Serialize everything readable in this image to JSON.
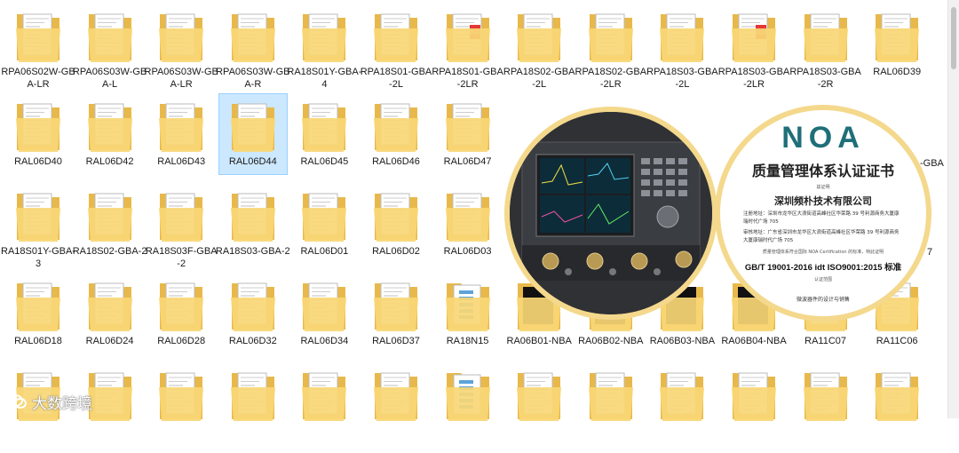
{
  "explorer": {
    "selected_index": 16,
    "items": [
      {
        "name": "RPA06S02W-GBA-LR",
        "variant": "doc"
      },
      {
        "name": "RPA06S03W-GBA-L",
        "variant": "doc"
      },
      {
        "name": "RPA06S03W-GBA-LR",
        "variant": "doc"
      },
      {
        "name": "RPA06S03W-GBA-R",
        "variant": "doc"
      },
      {
        "name": "RA18S01Y-GBA-4",
        "variant": "doc"
      },
      {
        "name": "RPA18S01-GBA-2L",
        "variant": "doc"
      },
      {
        "name": "RPA18S01-GBA-2LR",
        "variant": "pdf"
      },
      {
        "name": "RPA18S02-GBA-2L",
        "variant": "doc"
      },
      {
        "name": "RPA18S02-GBA-2LR",
        "variant": "doc"
      },
      {
        "name": "RPA18S03-GBA-2L",
        "variant": "doc"
      },
      {
        "name": "RPA18S03-GBA-2LR",
        "variant": "pdf"
      },
      {
        "name": "RPA18S03-GBA-2R",
        "variant": "doc"
      },
      {
        "name": "RAL06D39",
        "variant": "doc"
      },
      {
        "name": "RAL06D40",
        "variant": "doc"
      },
      {
        "name": "RAL06D42",
        "variant": "doc"
      },
      {
        "name": "RAL06D43",
        "variant": "doc"
      },
      {
        "name": "RAL06D44",
        "variant": "doc"
      },
      {
        "name": "RAL06D45",
        "variant": "doc"
      },
      {
        "name": "RAL06D46",
        "variant": "doc"
      },
      {
        "name": "RAL06D47",
        "variant": "doc"
      },
      {
        "name": "",
        "variant": "hidden"
      },
      {
        "name": "",
        "variant": "hidden"
      },
      {
        "name": "",
        "variant": "hidden"
      },
      {
        "name": "",
        "variant": "hidden"
      },
      {
        "name": "",
        "variant": "hidden"
      },
      {
        "name": "",
        "variant": "hidden"
      },
      {
        "name": "RA18S01Y-GBA-3",
        "variant": "doc"
      },
      {
        "name": "RA18S02-GBA-2",
        "variant": "doc"
      },
      {
        "name": "RA18S03F-GBA-2",
        "variant": "doc"
      },
      {
        "name": "RA18S03-GBA-2",
        "variant": "doc"
      },
      {
        "name": "RAL06D01",
        "variant": "doc"
      },
      {
        "name": "RAL06D02",
        "variant": "doc"
      },
      {
        "name": "RAL06D03",
        "variant": "doc"
      },
      {
        "name": "",
        "variant": "hidden"
      },
      {
        "name": "",
        "variant": "hidden"
      },
      {
        "name": "",
        "variant": "hidden"
      },
      {
        "name": "",
        "variant": "hidden"
      },
      {
        "name": "",
        "variant": "hidden"
      },
      {
        "name": "",
        "variant": "hidden"
      },
      {
        "name": "RAL06D18",
        "variant": "doc"
      },
      {
        "name": "RAL06D24",
        "variant": "doc"
      },
      {
        "name": "RAL06D28",
        "variant": "doc"
      },
      {
        "name": "RAL06D32",
        "variant": "doc"
      },
      {
        "name": "RAL06D34",
        "variant": "doc"
      },
      {
        "name": "RAL06D37",
        "variant": "doc"
      },
      {
        "name": "RA18N15",
        "variant": "blue"
      },
      {
        "name": "RA06B01-NBA",
        "variant": "dark"
      },
      {
        "name": "RA06B02-NBA",
        "variant": "dark"
      },
      {
        "name": "RA06B03-NBA",
        "variant": "dark"
      },
      {
        "name": "RA06B04-NBA",
        "variant": "dark"
      },
      {
        "name": "RA11C07",
        "variant": "doc"
      },
      {
        "name": "RA11C06",
        "variant": "doc"
      },
      {
        "name": "",
        "variant": "doc"
      },
      {
        "name": "",
        "variant": "doc"
      },
      {
        "name": "",
        "variant": "doc"
      },
      {
        "name": "",
        "variant": "doc"
      },
      {
        "name": "",
        "variant": "doc"
      },
      {
        "name": "",
        "variant": "doc"
      },
      {
        "name": "",
        "variant": "blue"
      },
      {
        "name": "",
        "variant": "doc"
      },
      {
        "name": "",
        "variant": "doc"
      },
      {
        "name": "",
        "variant": "doc"
      },
      {
        "name": "",
        "variant": "doc"
      },
      {
        "name": "",
        "variant": "doc"
      },
      {
        "name": "",
        "variant": "doc"
      }
    ],
    "partial_labels": {
      "row2_right": "-GBA",
      "row3_right": "7"
    }
  },
  "certificate": {
    "logo": "NOA",
    "title": "质量管理体系认证证书",
    "sub": "兹证明",
    "company": "深圳频朴技术有限公司",
    "addr1": "注册地址：深圳市龙华区大浪街道高峰社区华荣路 39 号利源商务大厦康瑞时代广场 705",
    "addr2": "审核地址：广东省深圳市龙华区大浪街道高峰社区华荣路 39 号利源商务大厦康瑞时代广场 705",
    "note": "质量管理体系符合国际 NOA Certification 的标准，特此证明",
    "standard": "GB/T 19001-2016 idt ISO9001:2015 标准",
    "scope_label": "认证范围",
    "scope": "微波器件的设计与销售"
  },
  "watermark": {
    "text": "大数跨境"
  },
  "colors": {
    "folder_back": "#e8b94a",
    "folder_front": "#f8d775",
    "selection": "#cce8ff",
    "ring": "#f4d88c",
    "logo": "#1f6f78"
  }
}
